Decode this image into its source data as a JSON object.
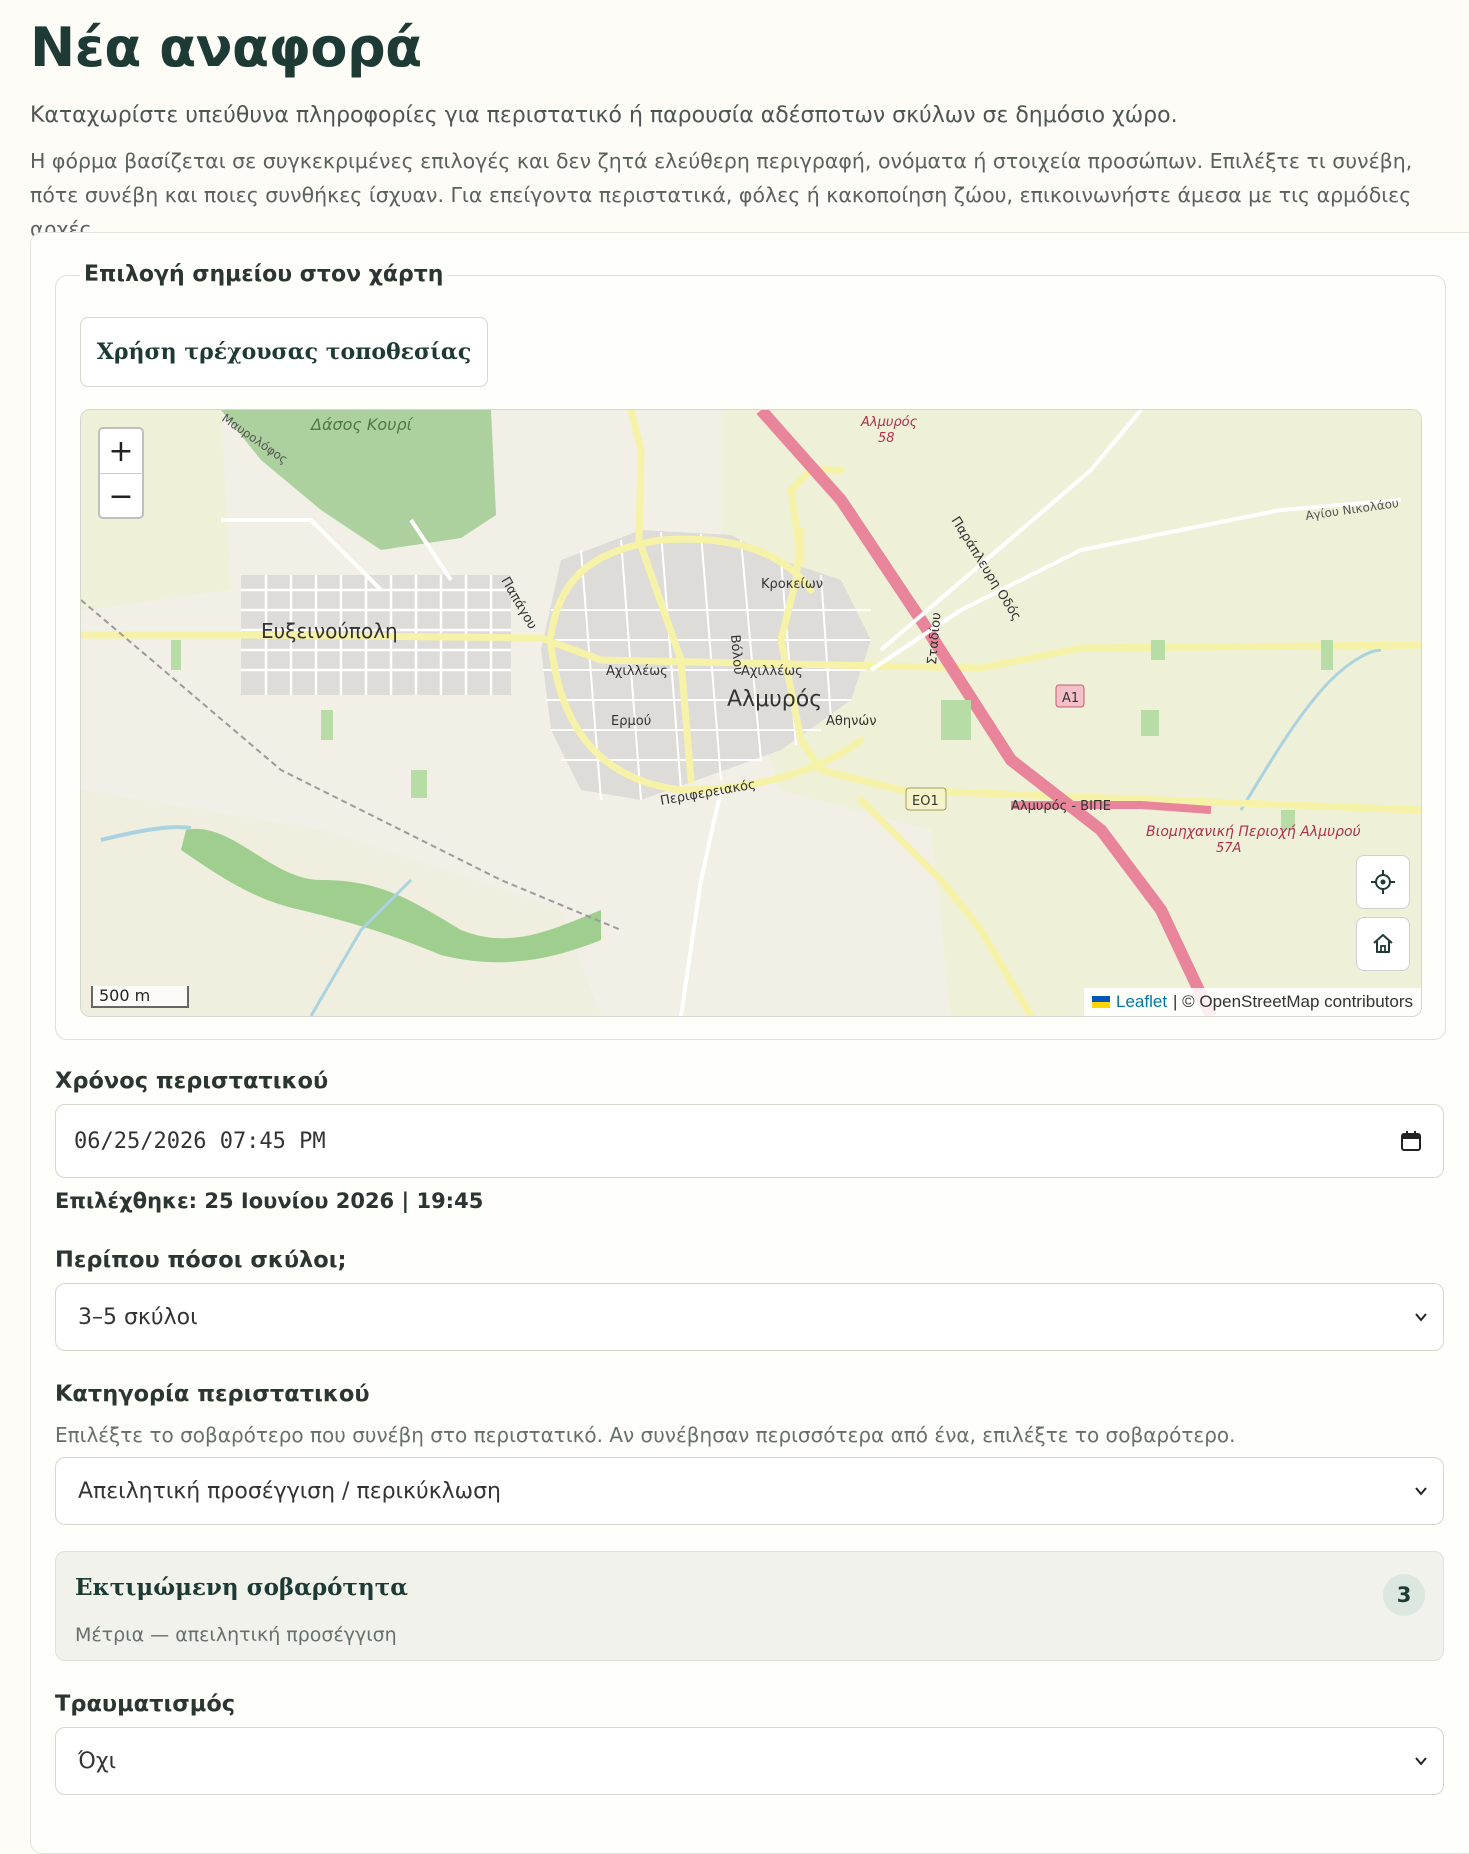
{
  "page": {
    "title": "Νέα αναφορά",
    "intro": "Καταχωρίστε υπεύθυνα πληροφορίες για περιστατικό ή παρουσία αδέσποτων σκύλων σε δημόσιο χώρο.",
    "note": "Η φόρμα βασίζεται σε συγκεκριμένες επιλογές και δεν ζητά ελεύθερη περιγραφή, ονόματα ή στοιχεία προσώπων. Επιλέξτε τι συνέβη, πότε συνέβη και ποιες συνθήκες ίσχυαν. Για επείγοντα περιστατικά, φόλες ή κακοποίηση ζώου, επικοινωνήστε άμεσα με τις αρμόδιες αρχές."
  },
  "map_section": {
    "legend": "Επιλογή σημείου στον χάρτη",
    "use_location_button": "Χρήση τρέχουσας τοποθεσίας",
    "zoom_in": "+",
    "zoom_out": "−",
    "scale": "500 m",
    "attribution_link": "Leaflet",
    "attribution_text": "| © OpenStreetMap contributors",
    "labels": {
      "forest": "Δάσος Κουρί",
      "town1": "Ευξεινούπολη",
      "town2": "Αλμυρός",
      "street_achilleos1": "Αχιλλέως",
      "street_achilleos2": "Αχιλλέως",
      "street_ermou": "Ερμού",
      "street_athinon": "Αθηνών",
      "street_krokeion": "Κροκείων",
      "street_papagou": "Παπάγου",
      "street_volou": "Βόλου",
      "street_stadiou": "Σταδίου",
      "street_periferiakos": "Περιφερειακός",
      "street_mavrolofos": "Μαυρολόφος",
      "road_paraplevri": "Παράπλευρη Οδός",
      "road_agiou_nikolaou": "Αγίου Νικολάου",
      "road_almyros_vipe": "Αλμυρός - ΒΙΠΕ",
      "road_a1": "A1",
      "road_eo1": "ΕΟ1",
      "exit_58_name": "Αλμυρός",
      "exit_58": "58",
      "industrial": "Βιομηχανική Περιοχή Αλμυρού",
      "exit_57a": "57A"
    }
  },
  "time_field": {
    "label": "Χρόνος περιστατικού",
    "value": "06/25/2026 07:45 PM",
    "selected_text": "Επιλέχθηκε: 25 Ιουνίου 2026 | 19:45"
  },
  "dogs_field": {
    "label": "Περίπου πόσοι σκύλοι;",
    "value": "3–5 σκύλοι"
  },
  "category_field": {
    "label": "Κατηγορία περιστατικού",
    "hint": "Επιλέξτε το σοβαρότερο που συνέβη στο περιστατικό. Αν συνέβησαν περισσότερα από ένα, επιλέξτε το σοβαρότερο.",
    "value": "Απειλητική προσέγγιση / περικύκλωση"
  },
  "severity": {
    "title": "Εκτιμώμενη σοβαρότητα",
    "value": "3",
    "description": "Μέτρια — απειλητική προσέγγιση"
  },
  "injury_field": {
    "label": "Τραυματισμός",
    "value": "Όχι"
  },
  "colors": {
    "primary": "#1d3b34",
    "background": "#fdfcf7",
    "motorway": "#e8859a",
    "primary_road": "#f6f3a8",
    "forest": "#add19e"
  }
}
